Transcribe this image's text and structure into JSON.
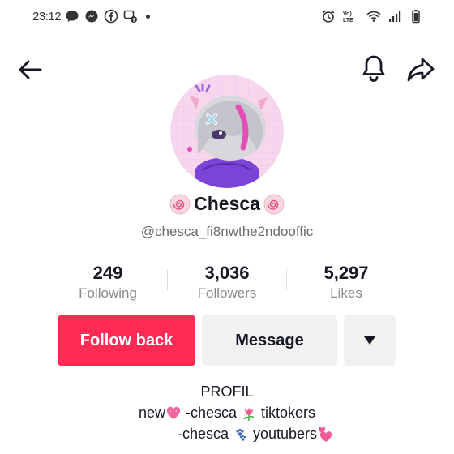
{
  "status_bar": {
    "time": "23:12",
    "left_icons": [
      "chat-bubble-icon",
      "messenger-icon",
      "facebook-icon",
      "chat-facebook-icon",
      "dot-icon"
    ],
    "right_icons": [
      "alarm-icon",
      "volte-icon",
      "wifi-icon",
      "signal-icon",
      "battery-icon"
    ],
    "volte_label": "Vo) LTE"
  },
  "nav": {
    "back_icon": "arrow-left-icon",
    "bell_icon": "bell-icon",
    "share_icon": "share-icon"
  },
  "profile": {
    "name": "Chesca",
    "handle": "@chesca_fi8nwthe2ndooffic",
    "name_decoration_icon": "pink-swirl-icon"
  },
  "stats": [
    {
      "value": "249",
      "label": "Following"
    },
    {
      "value": "3,036",
      "label": "Followers"
    },
    {
      "value": "5,297",
      "label": "Likes"
    }
  ],
  "actions": {
    "follow_label": "Follow back",
    "message_label": "Message",
    "more_icon": "caret-down-icon"
  },
  "bio": {
    "line1": "PROFIL",
    "line2_a": "new",
    "line2_b": "  -chesca ",
    "line2_c": " tiktokers",
    "line3_a": "-chesca ",
    "line3_b": " youtubers",
    "emojis": [
      "pink-heart-icon",
      "tulip-icon",
      "paw-prints-icon",
      "two-hearts-icon"
    ]
  },
  "colors": {
    "accent": "#fe2c55",
    "secondary_button": "#f1f1f2",
    "text": "#161823",
    "muted": "#8a8b91"
  }
}
